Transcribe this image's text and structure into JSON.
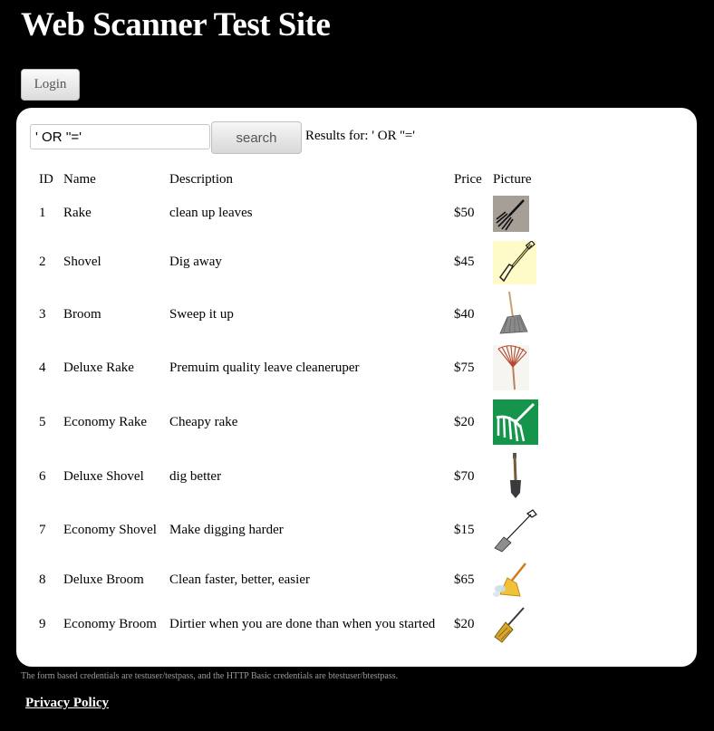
{
  "header": {
    "title": "Web Scanner Test Site"
  },
  "auth": {
    "login_label": "Login"
  },
  "search": {
    "value": "' OR ''='",
    "button_label": "search",
    "results_label": "Results for: ' OR ''='"
  },
  "table": {
    "headers": {
      "id": "ID",
      "name": "Name",
      "description": "Description",
      "price": "Price",
      "picture": "Picture"
    },
    "rows": [
      {
        "id": "1",
        "name": "Rake",
        "description": "clean up leaves",
        "price": "$50",
        "picture": "rake-icon"
      },
      {
        "id": "2",
        "name": "Shovel",
        "description": "Dig away",
        "price": "$45",
        "picture": "shovel-icon"
      },
      {
        "id": "3",
        "name": "Broom",
        "description": "Sweep it up",
        "price": "$40",
        "picture": "broom-icon"
      },
      {
        "id": "4",
        "name": "Deluxe Rake",
        "description": "Premuim quality leave cleaneruper",
        "price": "$75",
        "picture": "fan-rake-icon"
      },
      {
        "id": "5",
        "name": "Economy Rake",
        "description": "Cheapy rake",
        "price": "$20",
        "picture": "green-rake-icon"
      },
      {
        "id": "6",
        "name": "Deluxe Shovel",
        "description": "dig better",
        "price": "$70",
        "picture": "spade-icon"
      },
      {
        "id": "7",
        "name": "Economy Shovel",
        "description": "Make digging harder",
        "price": "$15",
        "picture": "shovel-line-icon"
      },
      {
        "id": "8",
        "name": "Deluxe Broom",
        "description": "Clean faster, better, easier",
        "price": "$65",
        "picture": "cartoon-broom-icon"
      },
      {
        "id": "9",
        "name": "Economy Broom",
        "description": "Dirtier when you are done than when you started",
        "price": "$20",
        "picture": "small-broom-icon"
      }
    ]
  },
  "footer": {
    "note": "The form based credentials are testuser/testpass, and the HTTP Basic credentials are btestuser/btestpass.",
    "privacy_label": "Privacy Policy"
  }
}
